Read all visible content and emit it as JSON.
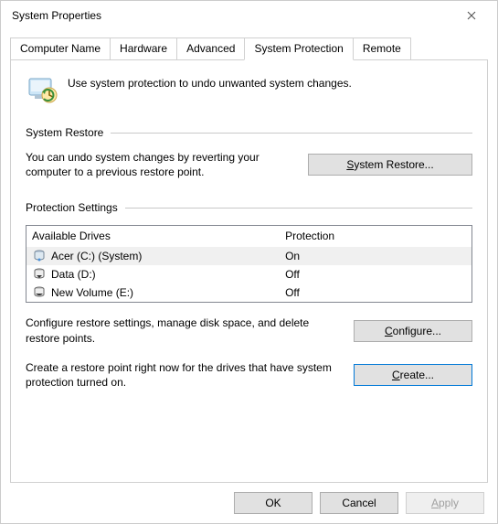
{
  "window": {
    "title": "System Properties"
  },
  "tabs": {
    "computer_name": "Computer Name",
    "hardware": "Hardware",
    "advanced": "Advanced",
    "system_protection": "System Protection",
    "remote": "Remote"
  },
  "intro": "Use system protection to undo unwanted system changes.",
  "restore": {
    "group_title": "System Restore",
    "desc": "You can undo system changes by reverting your computer to a previous restore point.",
    "button_pre": "S",
    "button_post": "ystem Restore..."
  },
  "protection": {
    "group_title": "Protection Settings",
    "header_drives": "Available Drives",
    "header_prot": "Protection",
    "drives": [
      {
        "label": "Acer (C:) (System)",
        "protection": "On",
        "selected": true
      },
      {
        "label": "Data (D:)",
        "protection": "Off",
        "selected": false
      },
      {
        "label": "New Volume (E:)",
        "protection": "Off",
        "selected": false
      }
    ],
    "configure_desc": "Configure restore settings, manage disk space, and delete restore points.",
    "configure_pre": "C",
    "configure_post": "onfigure...",
    "create_desc": "Create a restore point right now for the drives that have system protection turned on.",
    "create_pre": "C",
    "create_post": "reate..."
  },
  "footer": {
    "ok": "OK",
    "cancel": "Cancel",
    "apply_pre": "A",
    "apply_post": "pply"
  }
}
